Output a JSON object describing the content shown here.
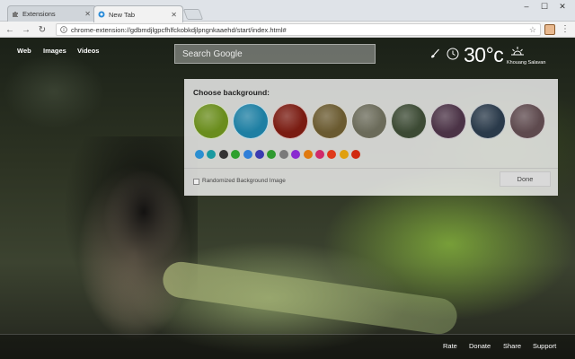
{
  "browser": {
    "tabs": [
      {
        "title": "Extensions",
        "icon": "puzzle-icon"
      },
      {
        "title": "New Tab",
        "icon": "newtab-page-icon"
      }
    ],
    "window_controls": {
      "minimize": "–",
      "maximize": "☐",
      "close": "✕"
    },
    "nav": {
      "back": "←",
      "forward": "→",
      "reload": "↻"
    },
    "url": "chrome-extension://gdbmdjlgpcfhlfckobkdjlpngnkaaehd/start/index.html#",
    "star": "☆",
    "menu": "⋮"
  },
  "nav_links": {
    "web": "Web",
    "images": "Images",
    "videos": "Videos"
  },
  "search": {
    "placeholder": "Search Google"
  },
  "weather": {
    "temperature": "30°c",
    "location": "Khouang Salavan"
  },
  "chooser": {
    "title": "Choose background:",
    "thumbnails": [
      {
        "color": "#6a8d1d"
      },
      {
        "color": "#1e7fa3"
      },
      {
        "color": "#7a1c12"
      },
      {
        "color": "#6a5a30"
      },
      {
        "color": "#6b6b5a"
      },
      {
        "color": "#3c4a34"
      },
      {
        "color": "#4b3346"
      },
      {
        "color": "#2a3a4a"
      },
      {
        "color": "#5e4a4e"
      }
    ],
    "swatches": [
      "#2b8fd1",
      "#1a9aa0",
      "#333333",
      "#2ea02e",
      "#2f7fd8",
      "#3b3bb0",
      "#2f9a2f",
      "#7a7a7a",
      "#8a2bd0",
      "#e07a10",
      "#d02a6a",
      "#e03a1a",
      "#e0a010",
      "#d02a10"
    ],
    "randomized_label": "Randomized Background Image",
    "done_label": "Done"
  },
  "footer": {
    "rate": "Rate",
    "donate": "Donate",
    "share": "Share",
    "support": "Support"
  }
}
